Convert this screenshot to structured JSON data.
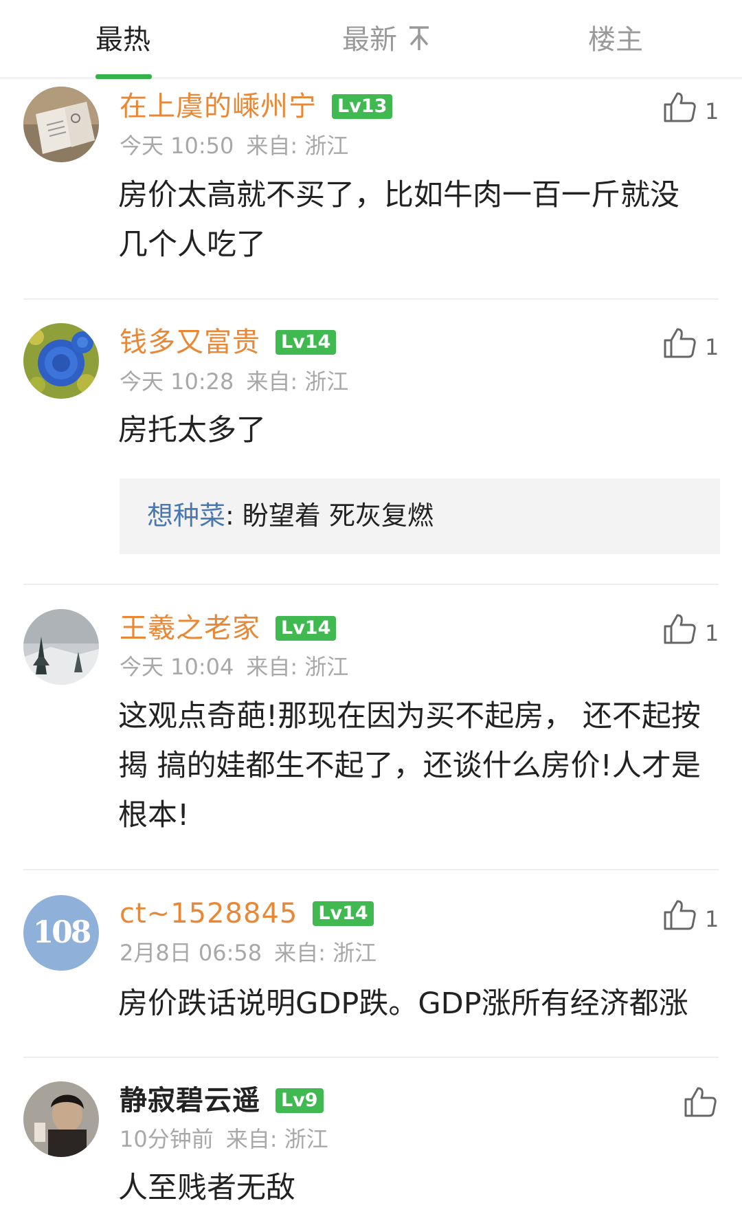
{
  "tabs": [
    {
      "label": "最热",
      "active": true
    },
    {
      "label": "最新"
    },
    {
      "label": "楼主"
    }
  ],
  "sort_icon": "sort-toggle-icon",
  "comments": [
    {
      "username": "在上虞的嵊州宁",
      "level": "Lv13",
      "time": "今天 10:50",
      "from": "来自: 浙江",
      "content": "房价太高就不买了，比如牛肉一百一斤就没几个人吃了",
      "likes": "1"
    },
    {
      "username": "钱多又富贵",
      "level": "Lv14",
      "time": "今天 10:28",
      "from": "来自: 浙江",
      "content": "房托太多了",
      "likes": "1",
      "reply": {
        "author": "想种菜",
        "sep": ": ",
        "text": "盼望着 死灰复燃"
      }
    },
    {
      "username": "王羲之老家",
      "level": "Lv14",
      "time": "今天 10:04",
      "from": "来自: 浙江",
      "content": "这观点奇葩!那现在因为买不起房， 还不起按揭 搞的娃都生不起了，还谈什么房价!人才是根本!",
      "likes": "1"
    },
    {
      "username": "ct~1528845",
      "level": "Lv14",
      "time": "2月8日 06:58",
      "from": "来自: 浙江",
      "content": "房价跌话说明GDP跌。GDP涨所有经济都涨",
      "likes": "1",
      "avatar_text": "108"
    },
    {
      "username": "静寂碧云遥",
      "level": "Lv9",
      "time": "10分钟前",
      "from": "来自: 浙江",
      "content": "人至贱者无敌",
      "likes": ""
    }
  ],
  "colors": {
    "accent_green": "#34b34a",
    "level_badge": "#3fb950",
    "username_orange": "#e98734",
    "reply_author_blue": "#4a78b0",
    "meta_gray": "#a8a8a8"
  }
}
